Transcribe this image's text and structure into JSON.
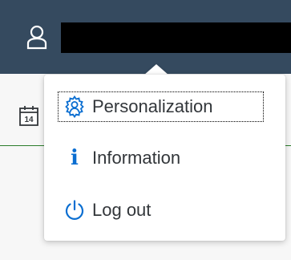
{
  "header": {
    "user_icon": "user-icon",
    "user_name": "[redacted]"
  },
  "background": {
    "calendar_icon": "calendar-icon",
    "calendar_day": "14"
  },
  "menu": {
    "items": [
      {
        "label": "Personalization",
        "icon": "personalization-icon",
        "focused": true
      },
      {
        "label": "Information",
        "icon": "information-icon"
      },
      {
        "label": "Log out",
        "icon": "logout-icon"
      }
    ]
  },
  "colors": {
    "shell_header": "#354a5f",
    "accent": "#0a6ed1",
    "text": "#32363a",
    "separator_green": "#2b7d2b"
  }
}
